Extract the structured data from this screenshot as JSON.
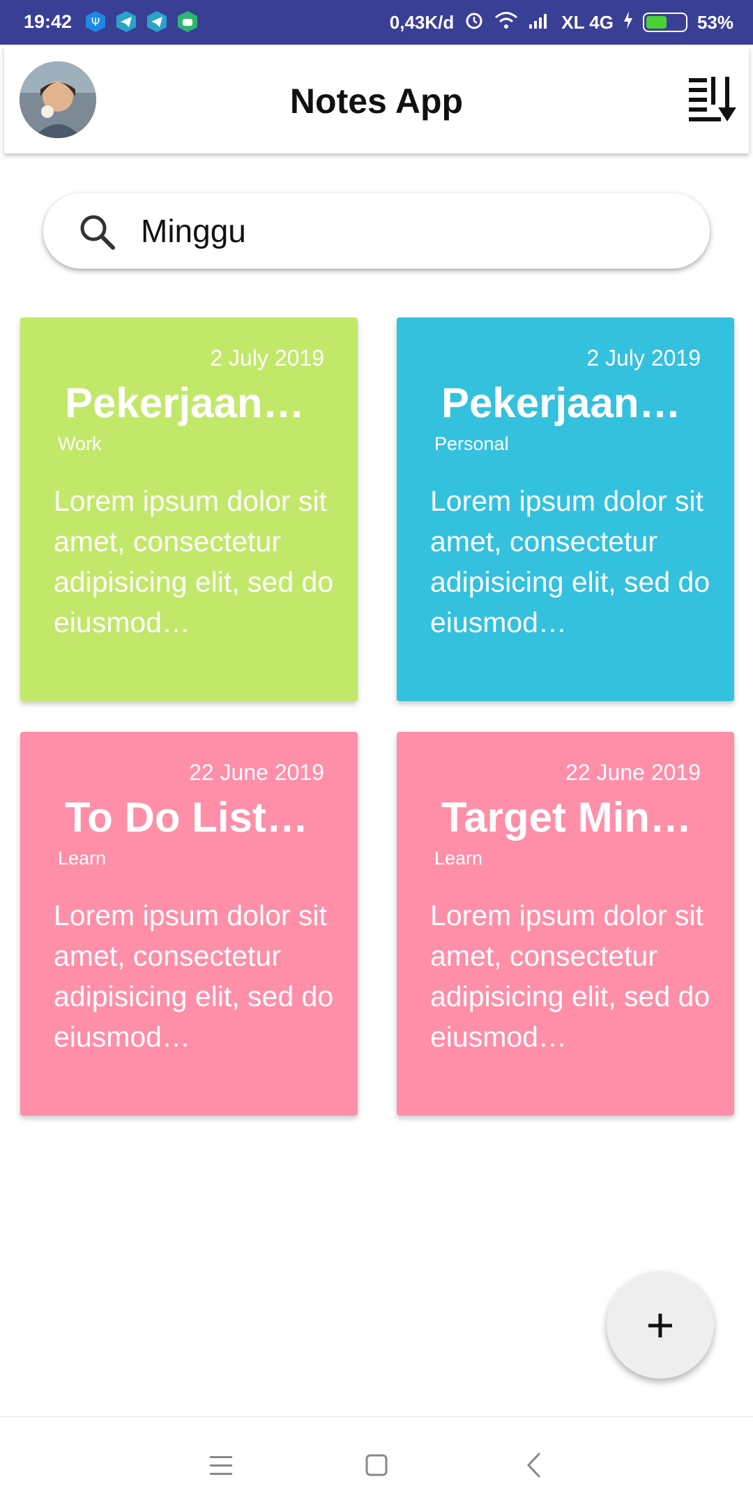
{
  "status_bar": {
    "time": "19:42",
    "network_speed": "0,43K/d",
    "carrier": "XL 4G",
    "battery": "53%",
    "battery_level": 0.53
  },
  "app_bar": {
    "title": "Notes App",
    "avatar_icon": "user-avatar",
    "sort_icon": "sort-descending-icon"
  },
  "search": {
    "value": "Minggu",
    "icon": "search-icon"
  },
  "notes": [
    {
      "date": "2 July 2019",
      "title": "Pekerjaan…",
      "category": "Work",
      "body": " Lorem ipsum dolor sit amet, consectetur adipisicing elit, sed do eiusmod…",
      "color": "#c2e86a"
    },
    {
      "date": "2 July 2019",
      "title": "Pekerjaan…",
      "category": "Personal",
      "body": " Lorem ipsum dolor sit amet, consectetur adipisicing elit, sed do eiusmod…",
      "color": "#33c1de"
    },
    {
      "date": "22 June 2019",
      "title": "To Do List…",
      "category": "Learn",
      "body": " Lorem ipsum dolor sit amet, consectetur adipisicing elit, sed do eiusmod…",
      "color": "#ff8fa8"
    },
    {
      "date": "22 June 2019",
      "title": "Target Min…",
      "category": "Learn",
      "body": " Lorem ipsum dolor sit amet, consectetur adipisicing elit, sed do eiusmod…",
      "color": "#ff8fa8"
    }
  ],
  "fab": {
    "label": "+",
    "icon": "add-icon"
  },
  "colors": {
    "status_bar": "#3a3f96",
    "accent_cursor": "#128f82"
  }
}
